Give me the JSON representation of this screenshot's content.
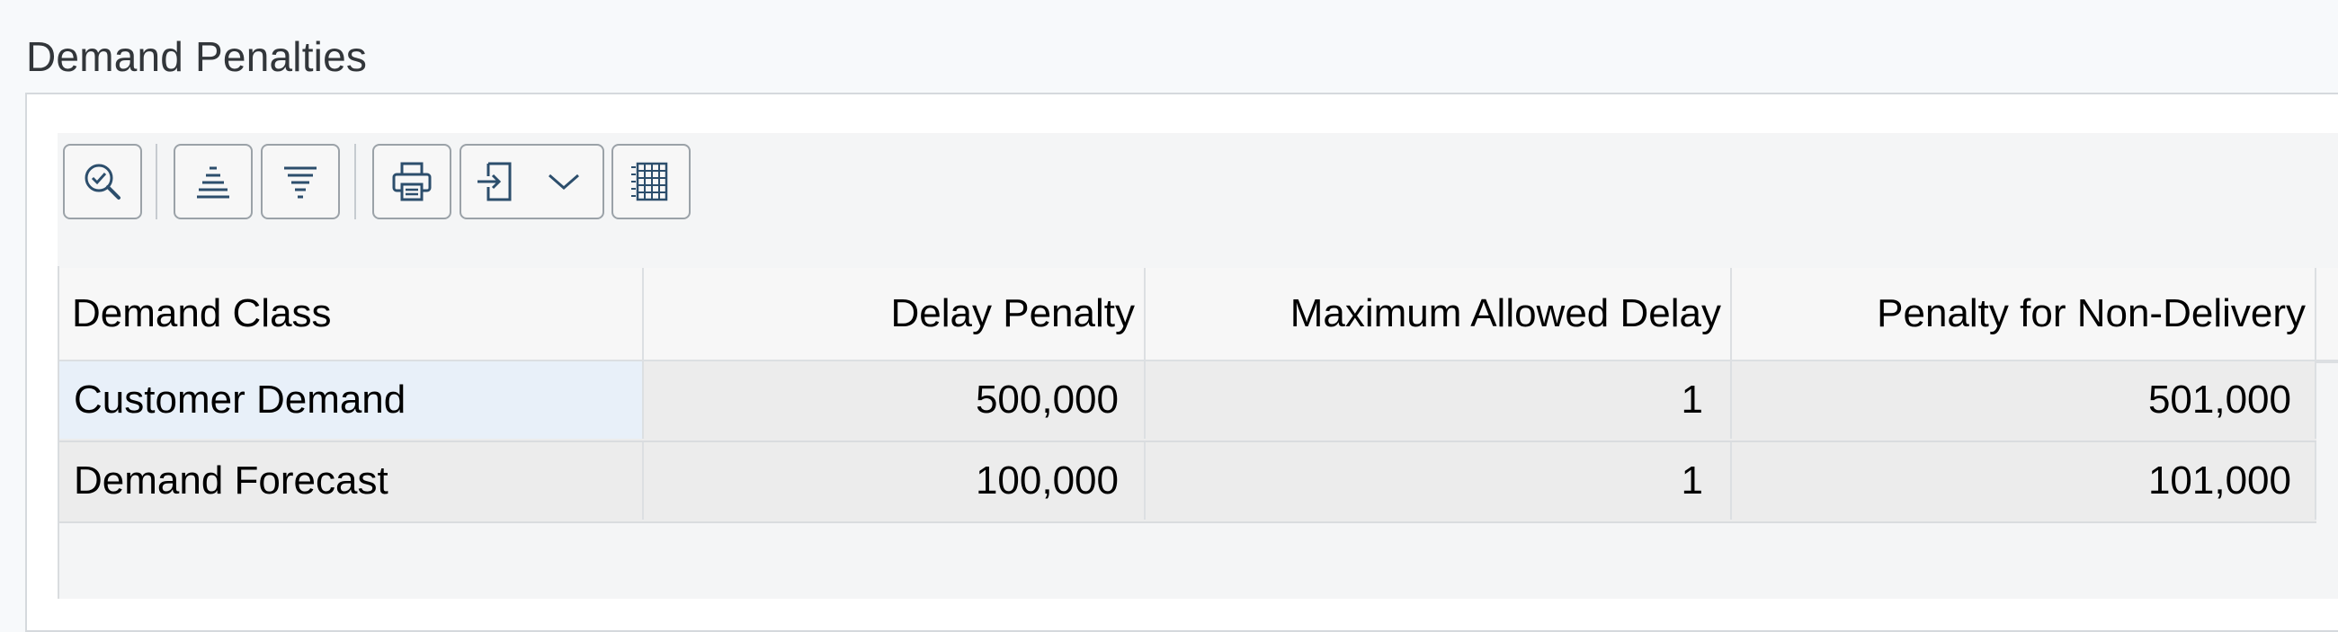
{
  "section": {
    "title": "Demand Penalties"
  },
  "toolbar": {
    "buttons": [
      {
        "name": "details-button",
        "icon": "magnifier-check-icon"
      },
      {
        "name": "sort-ascending-button",
        "icon": "sort-ascending-icon"
      },
      {
        "name": "sort-descending-button",
        "icon": "sort-descending-icon"
      },
      {
        "name": "print-button",
        "icon": "printer-icon"
      },
      {
        "name": "export-button",
        "icon": "export-icon"
      },
      {
        "name": "layout-button",
        "icon": "table-grid-icon"
      }
    ]
  },
  "table": {
    "columns": [
      "Demand Class",
      "Delay Penalty",
      "Maximum Allowed Delay",
      "Penalty for Non-Delivery"
    ],
    "rows": [
      [
        "Customer Demand",
        "500,000",
        "1",
        "501,000"
      ],
      [
        "Demand Forecast",
        "100,000",
        "1",
        "101,000"
      ]
    ]
  },
  "colors": {
    "header_bg": "#f7f7f7",
    "row_bg": "#ececec",
    "selected_cell_bg": "#e8f0f9",
    "border": "#d9dcdf"
  }
}
